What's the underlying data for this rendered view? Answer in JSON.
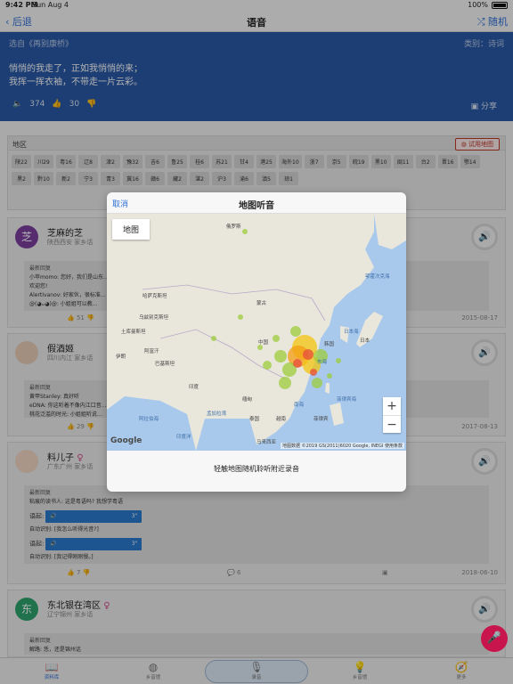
{
  "status": {
    "time": "9:42 PM",
    "date": "Sun Aug 4",
    "battery": "100%"
  },
  "nav": {
    "back": "后退",
    "title": "语音",
    "random": "随机"
  },
  "hero": {
    "source": "选自《再别康桥》",
    "category": "类别：诗词",
    "line1": "悄悄的我走了，正如我悄悄的来；",
    "line2": "我挥一挥衣袖，不带走一片云彩。",
    "plays": "374",
    "likes": "30",
    "share": "分享"
  },
  "region": {
    "title": "地区",
    "try_map": "试用地图",
    "tags": [
      "陕22",
      "川29",
      "粤16",
      "辽8",
      "津2",
      "豫32",
      "吉6",
      "鲁25",
      "桂6",
      "苏21",
      "甘4",
      "港25",
      "海外10",
      "浙7",
      "京5",
      "皖19",
      "黑10",
      "闽11",
      "台2",
      "晋16",
      "鄂14",
      "黑2",
      "黔10",
      "新2",
      "宁3",
      "青3",
      "冀16",
      "赣6",
      "藏2",
      "湛2",
      "沪3",
      "渝6",
      "滇5",
      "琼1"
    ]
  },
  "cards": [
    {
      "avatar": "芝",
      "name": "芝麻的芝",
      "location": "陕西西安 家乡话",
      "reply_title": "最新回复",
      "reply_lines": [
        "小苹momo: 您好，我们是山东…",
        "欢迎您!",
        "AlertIvanov: 好家伙，很标准…",
        "@(◕ᴗ◕)@: 小姐姐可以教…"
      ],
      "likes": "51",
      "date": "2015-08-17"
    },
    {
      "name": "假酒姬",
      "location": "四川内江 家乡话",
      "reply_title": "最新回复",
      "reply_lines": [
        "黄甲Stanley: 真好听",
        "eDNA: 你这听着不像内江口音…",
        "桃花泛滥的时光: 小姐姐听说…"
      ],
      "likes": "29",
      "date": "2017-08-13"
    },
    {
      "name": "料儿子",
      "location": "广东广州 家乡话",
      "reply_title": "最新回复",
      "reply_line1": "粘痕的读书人: 这是粤语吗? 我想学粤语",
      "voice_label": "语起:",
      "voice_dur": "3\"",
      "auto_label": "自动识别: [我怎么听得光音?]",
      "voice2_label": "语起:",
      "voice2_dur": "3\"",
      "auto2_label": "自动识别: [我记得刚刚慢。]",
      "likes": "7",
      "comments": "6",
      "date": "2018-06-10"
    },
    {
      "avatar": "东",
      "name": "东北银在湾区",
      "location": "辽宁锦州 家乡话",
      "reply_title": "最新回复",
      "reply_line1": "解路: 恁，还是锦州话"
    }
  ],
  "modal": {
    "cancel": "取消",
    "title": "地图听音",
    "map_button": "地图",
    "zoom_in": "+",
    "zoom_out": "−",
    "google": "Google",
    "attribution": "地图数据 ©2019 GS(2011)6020 Google, INEGI   使用条款",
    "hint": "轻触地图随机聆听附近录音",
    "labels": {
      "russia": "俄罗斯",
      "kazakhstan": "哈萨克斯坦",
      "mongolia": "蒙古",
      "uzbekistan": "乌兹别克斯坦",
      "turkmenistan": "土库曼斯坦",
      "afghanistan": "阿富汗",
      "iran": "伊朗",
      "pakistan": "巴基斯坦",
      "india": "印度",
      "china": "中国",
      "korea": "韩国",
      "japan": "日本",
      "myanmar": "缅甸",
      "thailand": "泰国",
      "vietnam": "越南",
      "philippines": "菲律宾",
      "malaysia": "马来西亚",
      "sea_japan": "日本海",
      "sea_east": "东海",
      "sea_south": "南海",
      "bay_bengal": "孟加拉湾",
      "arabian_sea": "阿拉伯海",
      "philippine_sea": "菲律宾海",
      "okhotsk": "鄂霍次克海",
      "indian_ocean": "印度洋"
    }
  },
  "tabbar": {
    "library": "资料库",
    "hometown": "乡音馆",
    "record": "录音",
    "tips": "乡音馆",
    "more": "更多"
  }
}
